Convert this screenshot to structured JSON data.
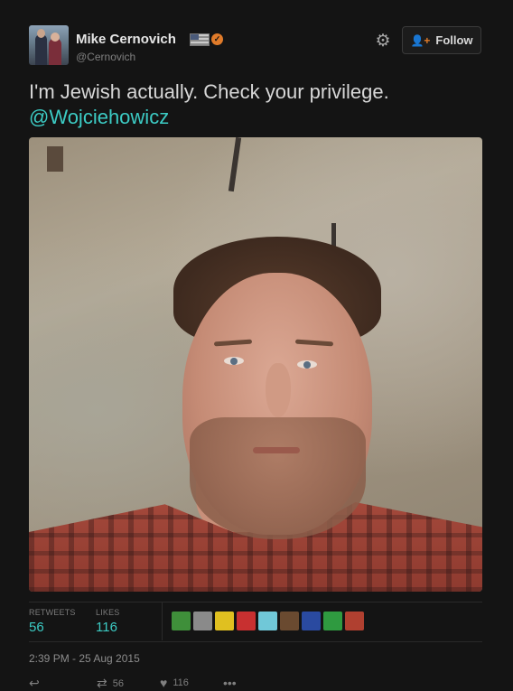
{
  "author": {
    "name": "Mike Cernovich",
    "handle": "@Cernovich",
    "avatar_icon": "profile-photo"
  },
  "header": {
    "settings_icon": "gear-icon",
    "follow_label": "Follow",
    "follow_icon": "add-user-icon"
  },
  "tweet": {
    "text": "I'm Jewish actually. Check your privilege.",
    "mention": "@Wojciehowicz",
    "image_alt": "selfie photo"
  },
  "stats": {
    "retweets_label": "RETWEETS",
    "retweets_value": "56",
    "likes_label": "LIKES",
    "likes_value": "116"
  },
  "likers": [
    {
      "color": "#3f8f3a"
    },
    {
      "color": "#8a8a8a"
    },
    {
      "color": "#e0c020"
    },
    {
      "color": "#c83030"
    },
    {
      "color": "#70c8d8"
    },
    {
      "color": "#6a4a30"
    },
    {
      "color": "#2a4aa0"
    },
    {
      "color": "#2f9a40"
    },
    {
      "color": "#b04030"
    }
  ],
  "timestamp": "2:39 PM - 25 Aug 2015",
  "actions": {
    "reply_icon": "reply-icon",
    "retweet_icon": "retweet-icon",
    "retweet_count": "56",
    "like_icon": "heart-icon",
    "like_count": "116",
    "more_icon": "more-icon"
  },
  "colors": {
    "accent": "#3ccbc4",
    "verified": "#e07b2a",
    "background": "#141414"
  }
}
